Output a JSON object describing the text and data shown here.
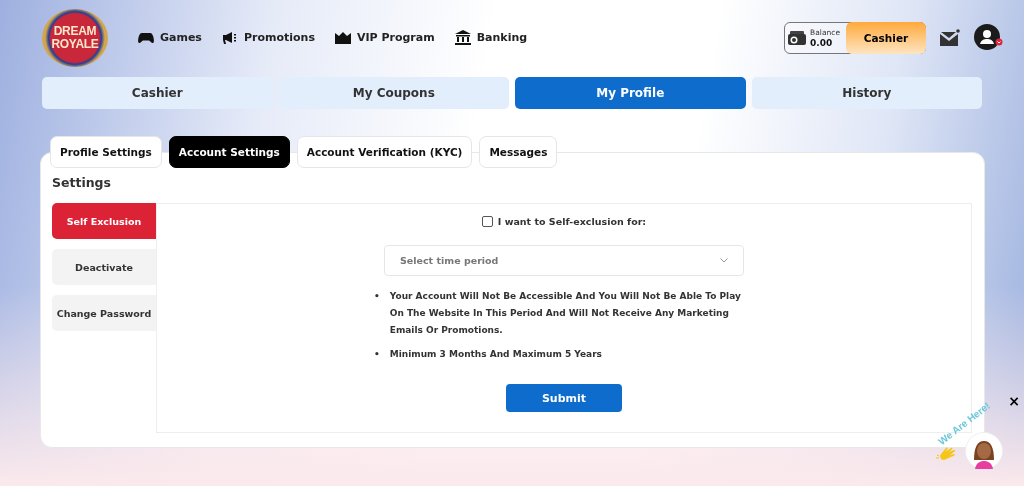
{
  "logo": {
    "lines": [
      "DREAM",
      "ROYALE"
    ]
  },
  "nav": [
    {
      "label": "Games",
      "kind": "gamepad"
    },
    {
      "label": "Promotions",
      "kind": "megaphone"
    },
    {
      "label": "VIP Program",
      "kind": "crown"
    },
    {
      "label": "Banking",
      "kind": "bank"
    }
  ],
  "balance": {
    "label": "Balance",
    "value": "0.00"
  },
  "cashier_button": "Cashier",
  "main_tabs": [
    {
      "label": "Cashier",
      "selected": false
    },
    {
      "label": "My Coupons",
      "selected": false
    },
    {
      "label": "My Profile",
      "selected": true
    },
    {
      "label": "History",
      "selected": false
    }
  ],
  "sub_tabs": [
    {
      "label": "Profile Settings",
      "selected": false
    },
    {
      "label": "Account Settings",
      "selected": true
    },
    {
      "label": "Account Verification (KYC)",
      "selected": false
    },
    {
      "label": "Messages",
      "selected": false
    }
  ],
  "section_title": "Settings",
  "side_menu": [
    {
      "label": "Self Exclusion",
      "selected": true
    },
    {
      "label": "Deactivate",
      "selected": false
    },
    {
      "label": "Change Password",
      "selected": false
    }
  ],
  "self_exclusion": {
    "checkbox_label": "I want to Self-exclusion for:",
    "checked": false,
    "period_select": {
      "placeholder": "Select time period"
    },
    "notes": [
      {
        "bullet": "•",
        "text": "Your Account Will Not Be Accessible And You Will Not Be Able To Play On The Website In This Period And Will Not Receive Any Marketing Emails Or Promotions."
      },
      {
        "bullet": "•",
        "text": "Minimum 3 Months And Maximum 5 Years"
      }
    ],
    "submit": "Submit"
  },
  "chat_widget": {
    "caption": "We Are Here!",
    "close": "×"
  }
}
